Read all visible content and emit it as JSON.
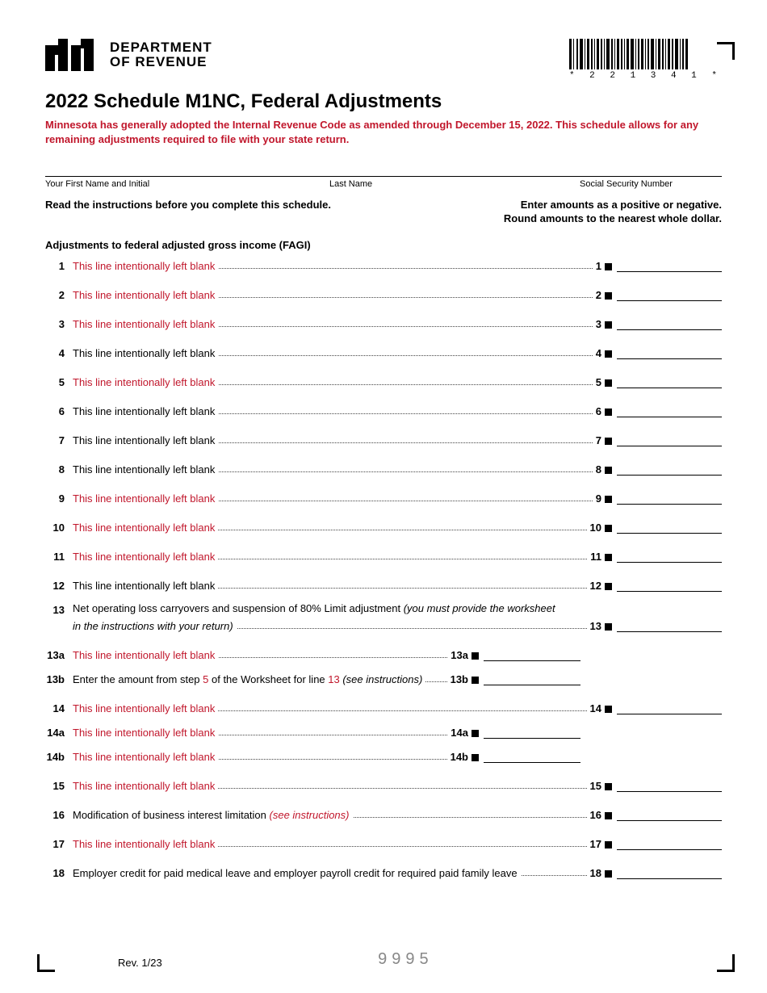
{
  "agency_line1": "DEPARTMENT",
  "agency_line2": "OF REVENUE",
  "barcode_text": "* 2 2 1 3 4 1 *",
  "title": "2022 Schedule M1NC, Federal Adjustments",
  "notice": "Minnesota has generally adopted the Internal Revenue Code as amended through December 15, 2022. This schedule allows for any remaining adjustments required to file with your state return.",
  "name_fields": {
    "first": "Your First Name and Initial",
    "last": "Last Name",
    "ssn": "Social Security Number"
  },
  "instructions_left": "Read the instructions before you complete this schedule.",
  "instructions_right_l1": "Enter amounts as a positive or negative.",
  "instructions_right_l2": "Round amounts to the nearest whole dollar.",
  "section_heading": "Adjustments to federal adjusted gross income (FAGI)",
  "lines": {
    "l1": {
      "num": "1",
      "text": "This line intentionally left blank",
      "red": true,
      "end": "1"
    },
    "l2": {
      "num": "2",
      "text": "This line intentionally left blank",
      "red": true,
      "end": "2"
    },
    "l3": {
      "num": "3",
      "text": "This line intentionally left blank",
      "red": true,
      "end": "3"
    },
    "l4": {
      "num": "4",
      "text": "This line intentionally left blank",
      "red": false,
      "end": "4"
    },
    "l5": {
      "num": "5",
      "text": "This line intentionally left blank",
      "red": true,
      "end": "5"
    },
    "l6": {
      "num": "6",
      "text": "This line intentionally left blank",
      "red": false,
      "end": "6"
    },
    "l7": {
      "num": "7",
      "text": "This line intentionally left blank",
      "red": false,
      "end": "7"
    },
    "l8": {
      "num": "8",
      "text": "This line intentionally left blank",
      "red": false,
      "end": "8"
    },
    "l9": {
      "num": "9",
      "text": "This line intentionally left blank",
      "red": true,
      "end": "9"
    },
    "l10": {
      "num": "10",
      "text": "This line intentionally left blank",
      "red": true,
      "end": "10"
    },
    "l11": {
      "num": "11",
      "text": "This line intentionally left blank",
      "red": true,
      "end": "11"
    },
    "l12": {
      "num": "12",
      "text": "This line intentionally left blank",
      "red": false,
      "end": "12"
    },
    "l13": {
      "num": "13",
      "text_a": "Net operating loss carryovers and suspension of 80% Limit adjustment ",
      "text_b": "(you must provide the worksheet",
      "text_c": "in the instructions with your return)",
      "end": "13"
    },
    "l13a": {
      "num": "13a",
      "text": "This line intentionally left blank",
      "red": true,
      "end": "13a"
    },
    "l13b": {
      "num": "13b",
      "text_a": "Enter the amount from step ",
      "text_b": "5",
      "text_c": " of the Worksheet for line ",
      "text_d": "13",
      "text_e": " (see instructions)",
      "end": "13b"
    },
    "l14": {
      "num": "14",
      "text": "This line intentionally left blank",
      "red": true,
      "end": "14"
    },
    "l14a": {
      "num": "14a",
      "text": "This line intentionally left blank",
      "red": true,
      "end": "14a"
    },
    "l14b": {
      "num": "14b",
      "text": "This line intentionally left blank",
      "red": true,
      "end": "14b"
    },
    "l15": {
      "num": "15",
      "text": "This line intentionally left blank",
      "red": true,
      "end": "15"
    },
    "l16": {
      "num": "16",
      "text_a": "Modification of business interest limitation ",
      "text_b": "(see instructions)",
      "end": "16"
    },
    "l17": {
      "num": "17",
      "text": "This line intentionally left blank",
      "red": true,
      "end": "17"
    },
    "l18": {
      "num": "18",
      "text": "Employer credit for paid medical leave and employer payroll credit for required paid family leave",
      "red": false,
      "end": "18"
    }
  },
  "footer": {
    "rev": "Rev. 1/23",
    "code": "9995"
  }
}
